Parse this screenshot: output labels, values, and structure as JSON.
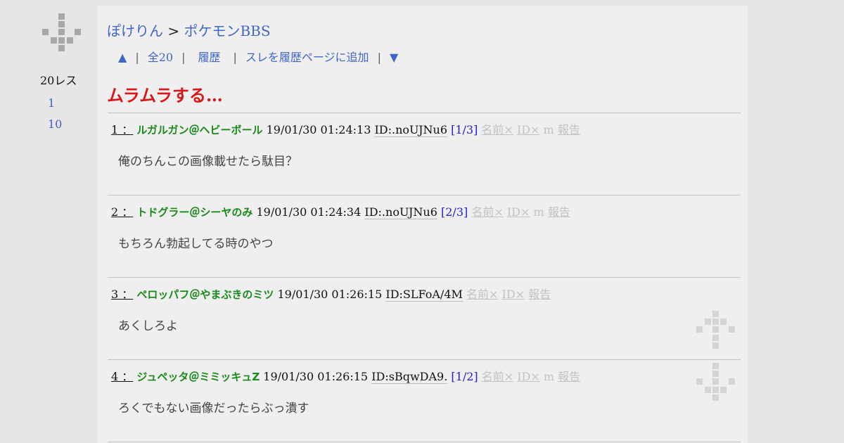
{
  "sidebar": {
    "res_count": "20レス",
    "links": [
      "1",
      "10"
    ]
  },
  "breadcrumb": {
    "site": "ぽけりん",
    "separator": " > ",
    "board": "ポケモンBBS"
  },
  "nav": {
    "up": "▲",
    "all": "全20",
    "history": "履歴",
    "add_history": "スレを履歴ページに追加",
    "down": "▼",
    "sep": "|"
  },
  "thread": {
    "title": "ムラムラする…"
  },
  "labels": {
    "name_hide": "名前×",
    "id_hide": "ID×",
    "m": "m",
    "report": "報告"
  },
  "posts": [
    {
      "num": "1 ：",
      "name": "ルガルガン＠ヘビーボール",
      "date": "19/01/30 01:24:13",
      "id": "ID:.noUJNu6",
      "count": "[1/3]",
      "body": "俺のちんこの画像載せたら駄目？"
    },
    {
      "num": "2 ：",
      "name": "トドグラー＠シーヤのみ",
      "date": "19/01/30 01:24:34",
      "id": "ID:.noUJNu6",
      "count": "[2/3]",
      "body": "もちろん勃起してる時のやつ"
    },
    {
      "num": "3 ：",
      "name": "ペロッパフ＠やまぶきのミツ",
      "date": "19/01/30 01:26:15",
      "id": "ID:SLFoA/4M",
      "count": "",
      "body": "あくしろよ"
    },
    {
      "num": "4 ：",
      "name": "ジュペッタ＠ミミッキュZ",
      "date": "19/01/30 01:26:15",
      "id": "ID:sBqwDA9.",
      "count": "[1/2]",
      "body": "ろくでもない画像だったらぶっ潰す"
    }
  ],
  "colors": {
    "link": "#4166c9",
    "title": "#d81818",
    "poster_name": "#1a8a1a",
    "count": "#2222cc",
    "muted": "#c2c2c2"
  }
}
